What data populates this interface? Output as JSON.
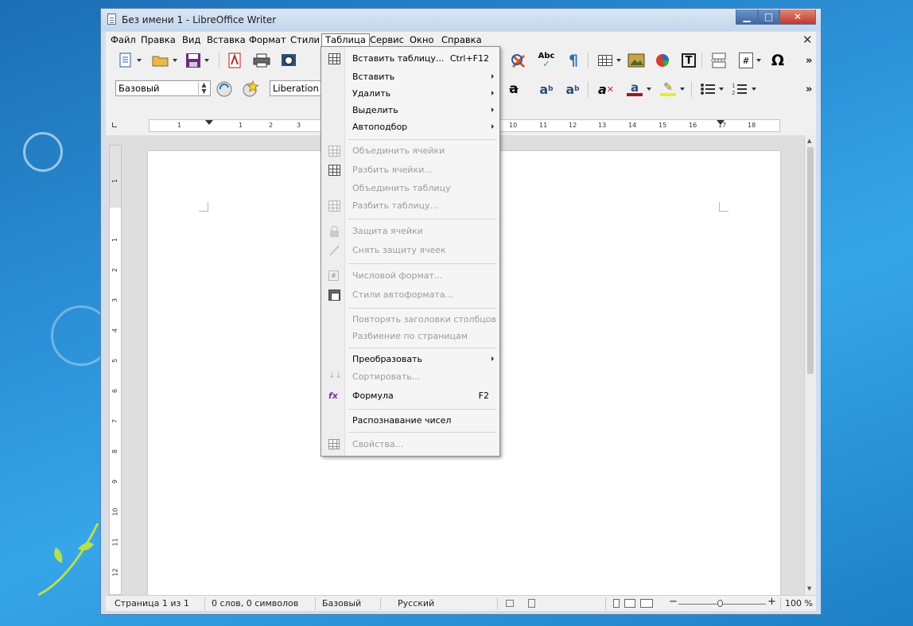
{
  "window": {
    "title": "Без имени 1 - LibreOffice Writer",
    "min_glyph": "▁",
    "max_glyph": "□",
    "close_glyph": "✕",
    "doc_close_glyph": "✕"
  },
  "menubar": {
    "items": [
      "Файл",
      "Правка",
      "Вид",
      "Вставка",
      "Формат",
      "Стили",
      "Таблица",
      "Сервис",
      "Окно",
      "Справка"
    ],
    "active": "Таблица"
  },
  "toolbar2": {
    "style_value": "Базовый",
    "font_value": "Liberation S"
  },
  "ruler": {
    "numbers": [
      "1",
      "1",
      "2",
      "3",
      "10",
      "11",
      "12",
      "13",
      "14",
      "15",
      "16",
      "17",
      "18"
    ]
  },
  "vruler": {
    "numbers": [
      "1",
      "1",
      "2",
      "3",
      "4",
      "5",
      "6",
      "7",
      "8",
      "9",
      "10",
      "11",
      "12"
    ]
  },
  "table_menu": {
    "insert_table": {
      "label": "Вставить таблицу...",
      "shortcut": "Ctrl+F12"
    },
    "insert": {
      "label": "Вставить"
    },
    "delete": {
      "label": "Удалить"
    },
    "select": {
      "label": "Выделить"
    },
    "autofit": {
      "label": "Автоподбор"
    },
    "merge_cells": {
      "label": "Объединить ячейки"
    },
    "split_cells": {
      "label": "Разбить ячейки..."
    },
    "merge_table": {
      "label": "Объединить таблицу"
    },
    "split_table": {
      "label": "Разбить таблицу..."
    },
    "protect_cells": {
      "label": "Защита ячейки"
    },
    "unprotect_cells": {
      "label": "Снять защиту ячеек"
    },
    "number_format": {
      "label": "Числовой формат..."
    },
    "autoformat": {
      "label": "Стили автоформата..."
    },
    "repeat_headers": {
      "label": "Повторять заголовки столбцов"
    },
    "page_break": {
      "label": "Разбиение по страницам"
    },
    "convert": {
      "label": "Преобразовать"
    },
    "sort": {
      "label": "Сортировать..."
    },
    "formula": {
      "label": "Формула",
      "shortcut": "F2"
    },
    "number_recognition": {
      "label": "Распознавание чисел"
    },
    "properties": {
      "label": "Свойства..."
    }
  },
  "statusbar": {
    "page": "Страница 1 из 1",
    "words": "0 слов, 0 символов",
    "style": "Базовый",
    "language": "Русский",
    "zoom": "100 %",
    "zoom_minus": "−",
    "zoom_plus": "+"
  },
  "colors": {
    "desktop": "#2b8fd6",
    "titlebar": "#c3d6ec",
    "font_color_bar": "#9e1b1b",
    "highlight_bar": "#f2ea1c"
  }
}
